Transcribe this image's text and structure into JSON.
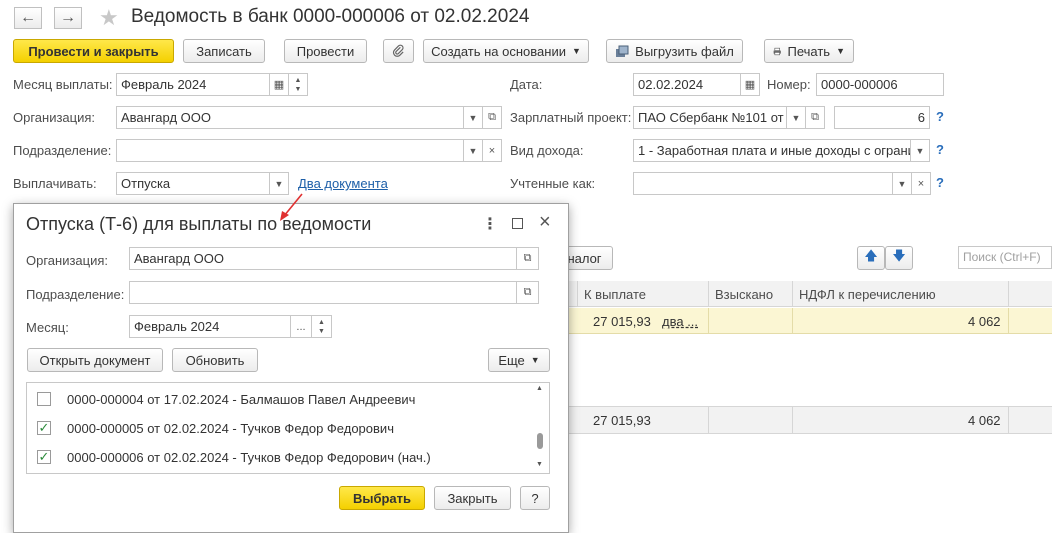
{
  "window": {
    "title": "Ведомость в банк 0000-000006 от 02.02.2024",
    "back_label": "←",
    "forward_label": "→",
    "star_label": "★"
  },
  "toolbar": {
    "post_close": "Провести и закрыть",
    "save": "Записать",
    "post": "Провести",
    "attach_icon": "📎",
    "create_based": "Создать на основании",
    "export": "Выгрузить файл",
    "print": "Печать"
  },
  "form": {
    "month_label": "Месяц выплаты:",
    "month_value": "Февраль 2024",
    "org_label": "Организация:",
    "org_value": "Авангард ООО",
    "dept_label": "Подразделение:",
    "dept_value": "",
    "pay_label": "Выплачивать:",
    "pay_value": "Отпуска",
    "docs_link": "Два документа",
    "date_label": "Дата:",
    "date_value": "02.02.2024",
    "number_label": "Номер:",
    "number_value": "0000-000006",
    "project_label": "Зарплатный проект:",
    "project_value": "ПАО Сбербанк №101 от",
    "project_count": "6",
    "income_label": "Вид дохода:",
    "income_value": "1 - Заработная плата и иные доходы с ограни",
    "accounted_label": "Учтенные как:",
    "accounted_value": "",
    "help": "?"
  },
  "grid": {
    "tax_button": "налог",
    "search_placeholder": "Поиск (Ctrl+F)",
    "headers": [
      "К выплате",
      "Взыскано",
      "НДФЛ к перечислению"
    ],
    "row": {
      "to_pay": "27 015,93",
      "docs": "два ...",
      "recovered": "",
      "ndfl": "4 062"
    },
    "total": {
      "to_pay": "27 015,93",
      "ndfl": "4 062"
    }
  },
  "modal": {
    "title": "Отпуска (Т-6) для выплаты по ведомости",
    "org_label": "Организация:",
    "org_value": "Авангард ООО",
    "dept_label": "Подразделение:",
    "dept_value": "",
    "month_label": "Месяц:",
    "month_value": "Февраль 2024",
    "open_doc": "Открыть документ",
    "refresh": "Обновить",
    "more": "Еще",
    "items": [
      {
        "checked": false,
        "text": "0000-000004 от 17.02.2024 - Балмашов Павел Андреевич"
      },
      {
        "checked": true,
        "text": "0000-000005 от 02.02.2024 - Тучков Федор Федорович"
      },
      {
        "checked": true,
        "text": "0000-000006 от 02.02.2024 - Тучков Федор Федорович (нач.)"
      }
    ],
    "select": "Выбрать",
    "close": "Закрыть",
    "help": "?"
  },
  "colors": {
    "primary": "#f4d000",
    "link": "#1d5fa8",
    "highlight_row": "#fbf6d3",
    "annotation_arrow": "#e03030"
  }
}
